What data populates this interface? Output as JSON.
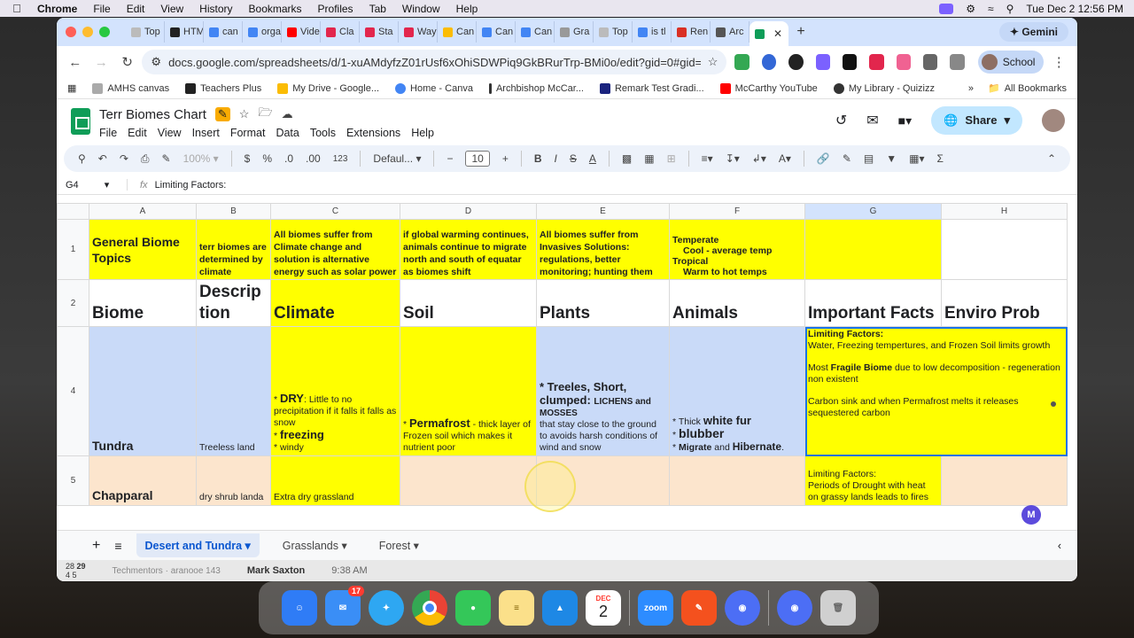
{
  "menubar": {
    "app": "Chrome",
    "items": [
      "File",
      "Edit",
      "View",
      "History",
      "Bookmarks",
      "Profiles",
      "Tab",
      "Window",
      "Help"
    ],
    "datetime": "Tue Dec 2  12:56 PM"
  },
  "browser": {
    "tabs": [
      "Top",
      "HTM",
      "can",
      "orga",
      "Vide",
      "Cla",
      "Sta",
      "Way",
      "Can",
      "Can",
      "Can",
      "Gra",
      "Top",
      "is tl",
      "Ren",
      "Arc"
    ],
    "gemini_label": "Gemini",
    "url": "docs.google.com/spreadsheets/d/1-xuAMdyfzZ01rUsf6xOhiSDWPiq9GkBRurTrp-BMi0o/edit?gid=0#gid=0",
    "profile_label": "School",
    "bookmarks": [
      "AMHS canvas",
      "Teachers Plus",
      "My Drive - Google...",
      "Home - Canva",
      "Archbishop McCar...",
      "Remark Test Gradi...",
      "McCarthy YouTube",
      "My Library - Quizizz"
    ],
    "all_bookmarks": "All Bookmarks"
  },
  "sheets": {
    "title": "Terr Biomes Chart",
    "menu": [
      "File",
      "Edit",
      "View",
      "Insert",
      "Format",
      "Data",
      "Tools",
      "Extensions",
      "Help"
    ],
    "share_label": "Share",
    "toolbar": {
      "zoom": "100%",
      "currency": "$",
      "percent": "%",
      "dec_less": ".0",
      "dec_more": ".00",
      "number_format": "123",
      "font": "Defaul...",
      "font_size": "10"
    },
    "cell_ref": "G4",
    "formula": "Limiting Factors:",
    "columns": [
      "A",
      "B",
      "C",
      "D",
      "E",
      "F",
      "G",
      "H"
    ],
    "row_numbers": [
      "1",
      "2",
      "4",
      "5"
    ],
    "rows": {
      "r1": {
        "a": "General Biome Topics",
        "b": "terr biomes are determined by climate",
        "c": "All biomes suffer from Climate change and solution is alternative energy such as solar power",
        "d": "if global warming continues, animals continue to migrate north and south of equatar as biomes shift",
        "e": "All biomes suffer from Invasives Solutions: regulations, better monitoring; hunting them",
        "f1": "Temperate",
        "f2": "Cool - average temp",
        "f3": "Tropical",
        "f4": "Warm to hot temps"
      },
      "r2": {
        "a": "Biome",
        "b": "Descrip tion",
        "c": "Climate",
        "d": "Soil",
        "e": "Plants",
        "f": "Animals",
        "g": "Important Facts",
        "h": "Enviro Prob"
      },
      "r4": {
        "a": "Tundra",
        "b": "Treeless land",
        "c1": "* ",
        "c2": "DRY",
        "c3": ": Little to no precipitation if it falls it falls as snow",
        "c4": "* ",
        "c5": "freezing",
        "c6": "* windy",
        "d1": "* ",
        "d2": "Permafrost",
        "d3": " - thick layer of Frozen soil which makes it nutrient poor",
        "e1": "* Treeles, Short, clumped: ",
        "e2": "LICHENS and MOSSES",
        "e3": "that stay close to the ground to avoids harsh conditions of wind and snow",
        "f1": "* Thick ",
        "f2": "white fur",
        "f3": "* ",
        "f4": "blubber",
        "f5": "* ",
        "f6": "Migrate",
        "f7": " and ",
        "f8": "Hibernate",
        "g1": "Limiting Factors:",
        "g2": "Water, Freezing tempertures, and Frozen Soil limits growth",
        "g3": "Most ",
        "g4": "Fragile Biome",
        "g5": " due to low decomposition - regeneration non existent",
        "g6": "Carbon sink and when Permafrost melts it releases sequestered carbon"
      },
      "r5": {
        "a": "Chapparal",
        "b": "dry shrub landa",
        "c": "Extra dry grassland",
        "g1": "Limiting Factors:",
        "g2": "Periods of Drought with heat on grassy lands leads to fires"
      }
    },
    "sheet_tabs": [
      "Desert and Tundra",
      "Grasslands",
      "Forest"
    ]
  },
  "behind_window": {
    "name": "Mark Saxton",
    "time": "9:38 AM",
    "cal1": "28",
    "cal2": "29",
    "cal3": "4",
    "cal4": "5",
    "text1": "Techmentors",
    "text2": "aranooe",
    "count": "143"
  },
  "dock": {
    "mail_badge": "17",
    "calendar_month": "DEC",
    "calendar_day": "2",
    "zoom_label": "zoom"
  },
  "colors": {
    "yellow": "#ffff00",
    "blue_fill": "#c9daf8",
    "peach_fill": "#fce5cd",
    "share_bg": "#c2e7ff",
    "tabstrip": "#d3e3fd"
  }
}
